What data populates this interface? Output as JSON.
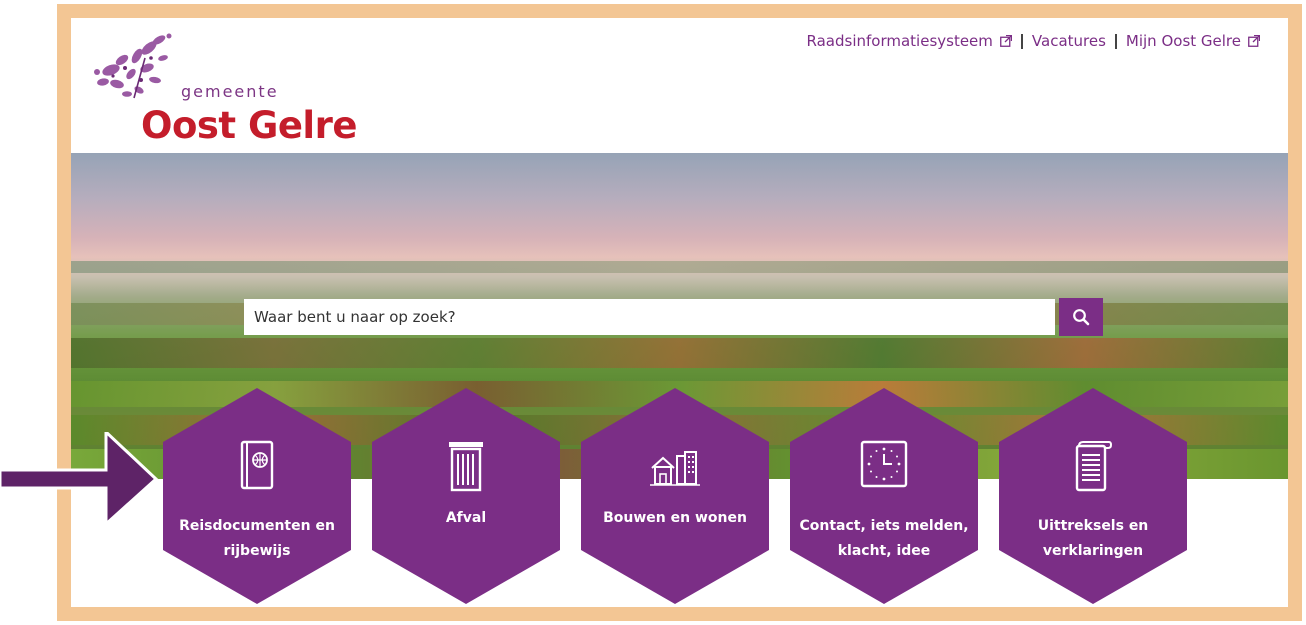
{
  "header": {
    "logo_small": "gemeente",
    "logo_big": "Oost Gelre",
    "links": [
      {
        "label": "Raadsinformatiesysteem",
        "external": true
      },
      {
        "label": "Vacatures",
        "external": false
      },
      {
        "label": "Mijn Oost Gelre",
        "external": true
      }
    ]
  },
  "search": {
    "placeholder": "Waar bent u naar op zoek?",
    "button_icon": "search-icon"
  },
  "tiles": [
    {
      "label": "Reisdocumenten en rijbewijs",
      "icon": "passport-icon"
    },
    {
      "label": "Afval",
      "icon": "trash-bin-icon"
    },
    {
      "label": "Bouwen en wonen",
      "icon": "buildings-icon"
    },
    {
      "label": "Contact, iets melden, klacht, idee",
      "icon": "clock-icon"
    },
    {
      "label": "Uittreksels en verklaringen",
      "icon": "document-scroll-icon"
    }
  ],
  "colors": {
    "brand_purple": "#7b2e86",
    "logo_red": "#c41d2b",
    "frame": "#f3c694",
    "arrow": "#5e2367"
  }
}
